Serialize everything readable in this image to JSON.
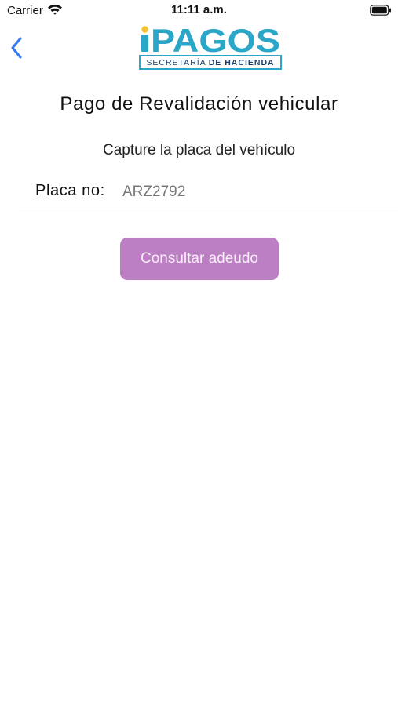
{
  "status_bar": {
    "carrier": "Carrier",
    "time": "11:11 a.m.",
    "wifi_icon": "wifi-icon",
    "battery_icon": "battery-icon"
  },
  "nav": {
    "back_icon": "chevron-left-icon",
    "accent_color": "#3478f6"
  },
  "logo": {
    "brand_i": "i",
    "brand": "PAGOS",
    "subtitle_regular": "SECRETARÍA",
    "subtitle_bold": "DE HACIENDA",
    "colors": {
      "primary": "#2aa6c8",
      "accent": "#f2c530",
      "text": "#1e3f6f"
    }
  },
  "page": {
    "title": "Pago de Revalidación vehicular",
    "instruction": "Capture la placa del vehículo",
    "plate_label": "Placa no:",
    "plate_value": "ARZ2792",
    "consult_button": "Consultar adeudo",
    "button_color": "#bd7fc4"
  }
}
